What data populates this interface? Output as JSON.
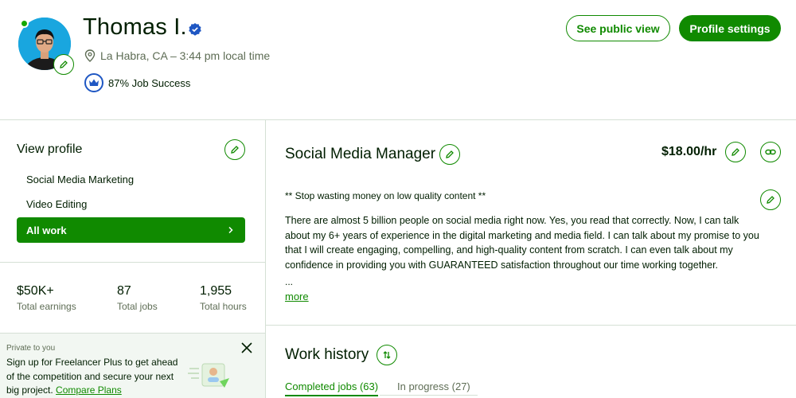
{
  "profile": {
    "name": "Thomas I.",
    "location": "La Habra, CA – 3:44 pm local time",
    "job_success": "87% Job Success",
    "icons": {
      "location": "location-pin-icon",
      "verified": "verified-badge-icon",
      "job_success": "crown-badge-icon",
      "online": "online-dot-icon"
    }
  },
  "header": {
    "see_public_view": "See public view",
    "profile_settings": "Profile settings"
  },
  "sidebar": {
    "title": "View profile",
    "items": [
      {
        "label": "Social Media Marketing"
      },
      {
        "label": "Video Editing"
      },
      {
        "label": "All work",
        "active": true
      }
    ],
    "stats": [
      {
        "value": "$50K+",
        "label": "Total earnings"
      },
      {
        "value": "87",
        "label": "Total jobs"
      },
      {
        "value": "1,955",
        "label": "Total hours"
      }
    ]
  },
  "promo": {
    "eyebrow": "Private to you",
    "text": "Sign up for Freelancer Plus to get ahead of the competition and secure your next big project.",
    "link": "Compare Plans"
  },
  "main": {
    "title": "Social Media Manager",
    "rate": "$18.00/hr",
    "overview_heading": "** Stop wasting money on low quality content **",
    "overview_body": "There are almost 5 billion people on social media right now. Yes, you read that correctly. Now, I can talk about my 6+ years of experience in the digital marketing and media field. I can talk about my promise to you that I will create engaging, compelling, and high-quality content from scratch. I can even talk about my confidence in providing you with GUARANTEED satisfaction throughout our time working together.",
    "ellipsis": "...",
    "more": "more"
  },
  "work_history": {
    "title": "Work history",
    "tabs": [
      {
        "label": "Completed jobs (63)",
        "active": true
      },
      {
        "label": "In progress (27)"
      }
    ]
  },
  "colors": {
    "brand_green": "#108a00",
    "avatar_bg": "#19a6df",
    "verified_blue": "#1f57c3"
  }
}
